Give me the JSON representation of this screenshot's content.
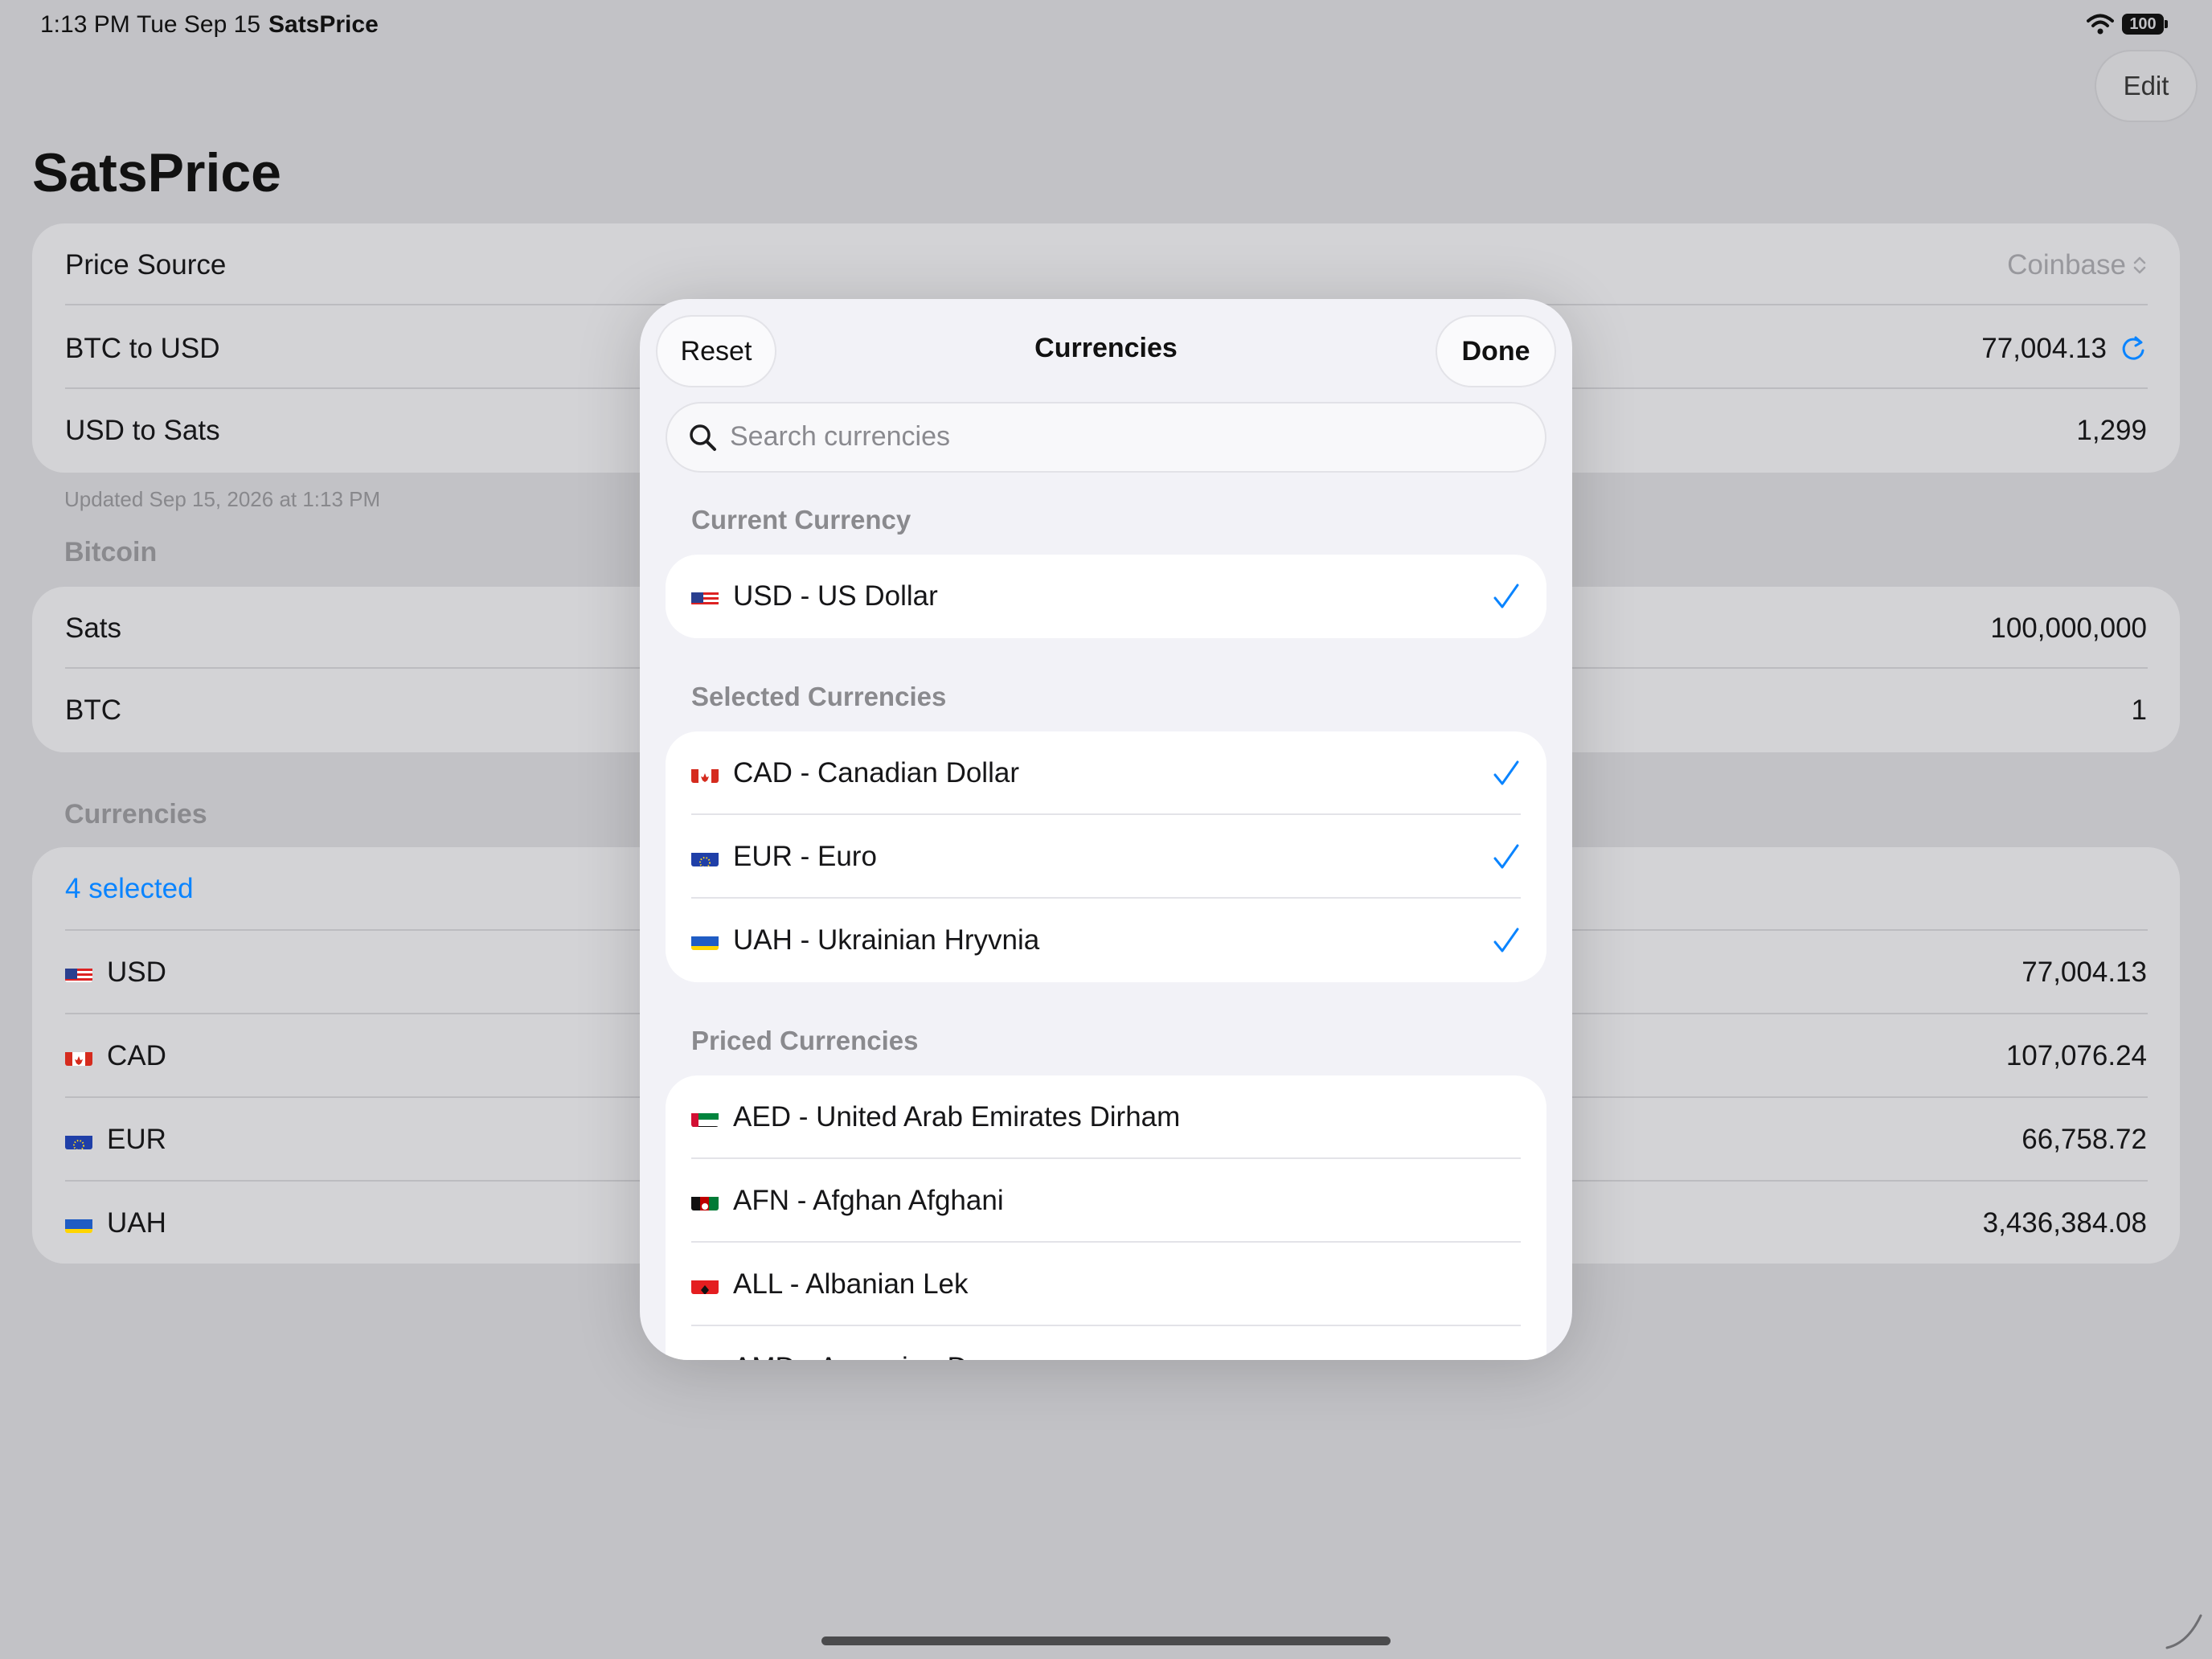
{
  "status_bar": {
    "time": "1:13 PM",
    "date": "Tue Sep 15",
    "app": "SatsPrice",
    "battery": "100"
  },
  "header": {
    "edit_label": "Edit",
    "title": "SatsPrice"
  },
  "price": {
    "source_label": "Price Source",
    "source_value": "Coinbase",
    "btc_usd_label": "BTC to USD",
    "btc_usd_value": "77,004.13",
    "usd_sats_label": "USD to Sats",
    "usd_sats_value": "1,299",
    "updated": "Updated Sep 15, 2026 at 1:13 PM"
  },
  "bitcoin": {
    "header": "Bitcoin",
    "sats_label": "Sats",
    "sats_value": "100,000,000",
    "btc_label": "BTC",
    "btc_value": "1"
  },
  "currencies": {
    "header": "Currencies",
    "selected_link": "4 selected",
    "rows": [
      {
        "code": "USD",
        "value": "77,004.13"
      },
      {
        "code": "CAD",
        "value": "107,076.24"
      },
      {
        "code": "EUR",
        "value": "66,758.72"
      },
      {
        "code": "UAH",
        "value": "3,436,384.08"
      }
    ]
  },
  "modal": {
    "reset_label": "Reset",
    "title": "Currencies",
    "done_label": "Done",
    "search_placeholder": "Search currencies",
    "current_header": "Current Currency",
    "current": [
      {
        "label": "USD - US Dollar",
        "checked": true
      }
    ],
    "selected_header": "Selected Currencies",
    "selected": [
      {
        "label": "CAD - Canadian Dollar",
        "checked": true
      },
      {
        "label": "EUR - Euro",
        "checked": true
      },
      {
        "label": "UAH - Ukrainian Hryvnia",
        "checked": true
      }
    ],
    "priced_header": "Priced Currencies",
    "priced": [
      {
        "label": "AED - United Arab Emirates Dirham"
      },
      {
        "label": "AFN - Afghan Afghani"
      },
      {
        "label": "ALL - Albanian Lek"
      },
      {
        "label": "AMD - Armenian Dram"
      }
    ]
  },
  "colors": {
    "accent": "#0a84ff",
    "background": "#c2c2c6",
    "sheet": "#f2f2f7"
  }
}
